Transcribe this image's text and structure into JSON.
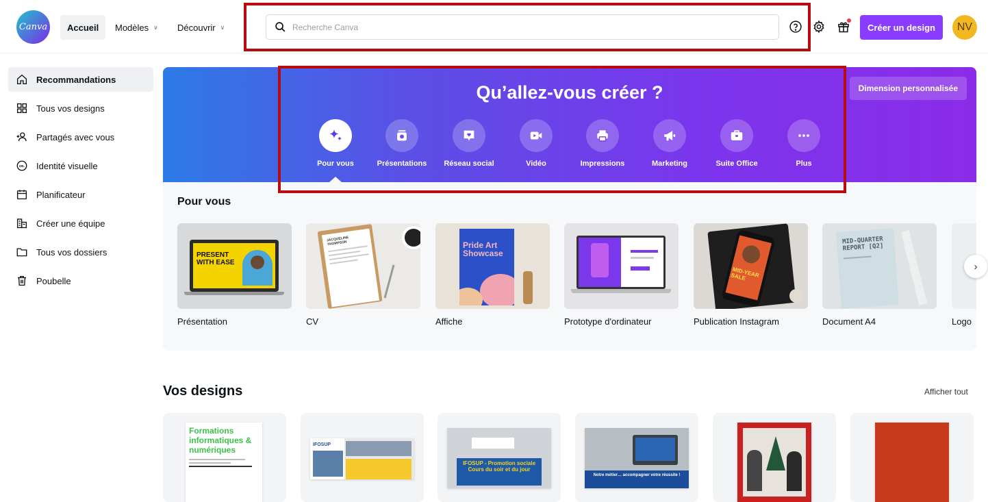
{
  "header": {
    "logo_text": "Canva",
    "nav": [
      {
        "label": "Accueil"
      },
      {
        "label": "Modèles"
      },
      {
        "label": "Découvrir"
      }
    ],
    "search_placeholder": "Recherche Canva",
    "create_button": "Créer un design",
    "avatar_initials": "NV",
    "icons": [
      "help-icon",
      "settings-icon",
      "gift-icon"
    ]
  },
  "sidebar": {
    "items": [
      {
        "label": "Recommandations",
        "icon": "home-icon"
      },
      {
        "label": "Tous vos designs",
        "icon": "grid-icon"
      },
      {
        "label": "Partagés avec vous",
        "icon": "users-icon"
      },
      {
        "label": "Identité visuelle",
        "icon": "brand-icon"
      },
      {
        "label": "Planificateur",
        "icon": "calendar-icon"
      },
      {
        "label": "Créer une équipe",
        "icon": "team-icon"
      },
      {
        "label": "Tous vos dossiers",
        "icon": "folder-icon"
      },
      {
        "label": "Poubelle",
        "icon": "trash-icon"
      }
    ]
  },
  "hero": {
    "title": "Qu’allez-vous créer ?",
    "custom_size_button": "Dimension personnalisée",
    "categories": [
      {
        "label": "Pour vous",
        "icon": "sparkle-icon"
      },
      {
        "label": "Présentations",
        "icon": "presentation-icon"
      },
      {
        "label": "Réseau social",
        "icon": "heart-chat-icon"
      },
      {
        "label": "Vidéo",
        "icon": "video-icon"
      },
      {
        "label": "Impressions",
        "icon": "printer-icon"
      },
      {
        "label": "Marketing",
        "icon": "megaphone-icon"
      },
      {
        "label": "Suite Office",
        "icon": "briefcase-icon"
      },
      {
        "label": "Plus",
        "icon": "more-icon"
      }
    ]
  },
  "for_you": {
    "title": "Pour vous",
    "cards": [
      {
        "label": "Présentation",
        "thumb_text": "PRESENT WITH EASE"
      },
      {
        "label": "CV",
        "thumb_text": "JACQUELINE THOMPSON"
      },
      {
        "label": "Affiche",
        "thumb_text": "Pride Art Showcase"
      },
      {
        "label": "Prototype d'ordinateur"
      },
      {
        "label": "Publication Instagram",
        "thumb_text": "MID-YEAR SALE"
      },
      {
        "label": "Document A4",
        "thumb_text": "MID-QUARTER REPORT [Q2]"
      },
      {
        "label": "Logo"
      }
    ]
  },
  "designs": {
    "title": "Vos designs",
    "view_all": "Afficher tout",
    "items": [
      {
        "thumb_text": "Formations informatiques & numériques"
      },
      {
        "thumb_text": "IFOSUP"
      },
      {
        "thumb_text": "IFOSUP - Promotion sociale Cours du soir et du jour"
      },
      {
        "thumb_text": "Notre métier… accompagner votre réussite !"
      },
      {
        "thumb_text": ""
      },
      {
        "thumb_text": ""
      }
    ]
  },
  "colors": {
    "accent": "#8b3dff",
    "avatar": "#f2b81f",
    "highlight_box": "#b80b10"
  }
}
